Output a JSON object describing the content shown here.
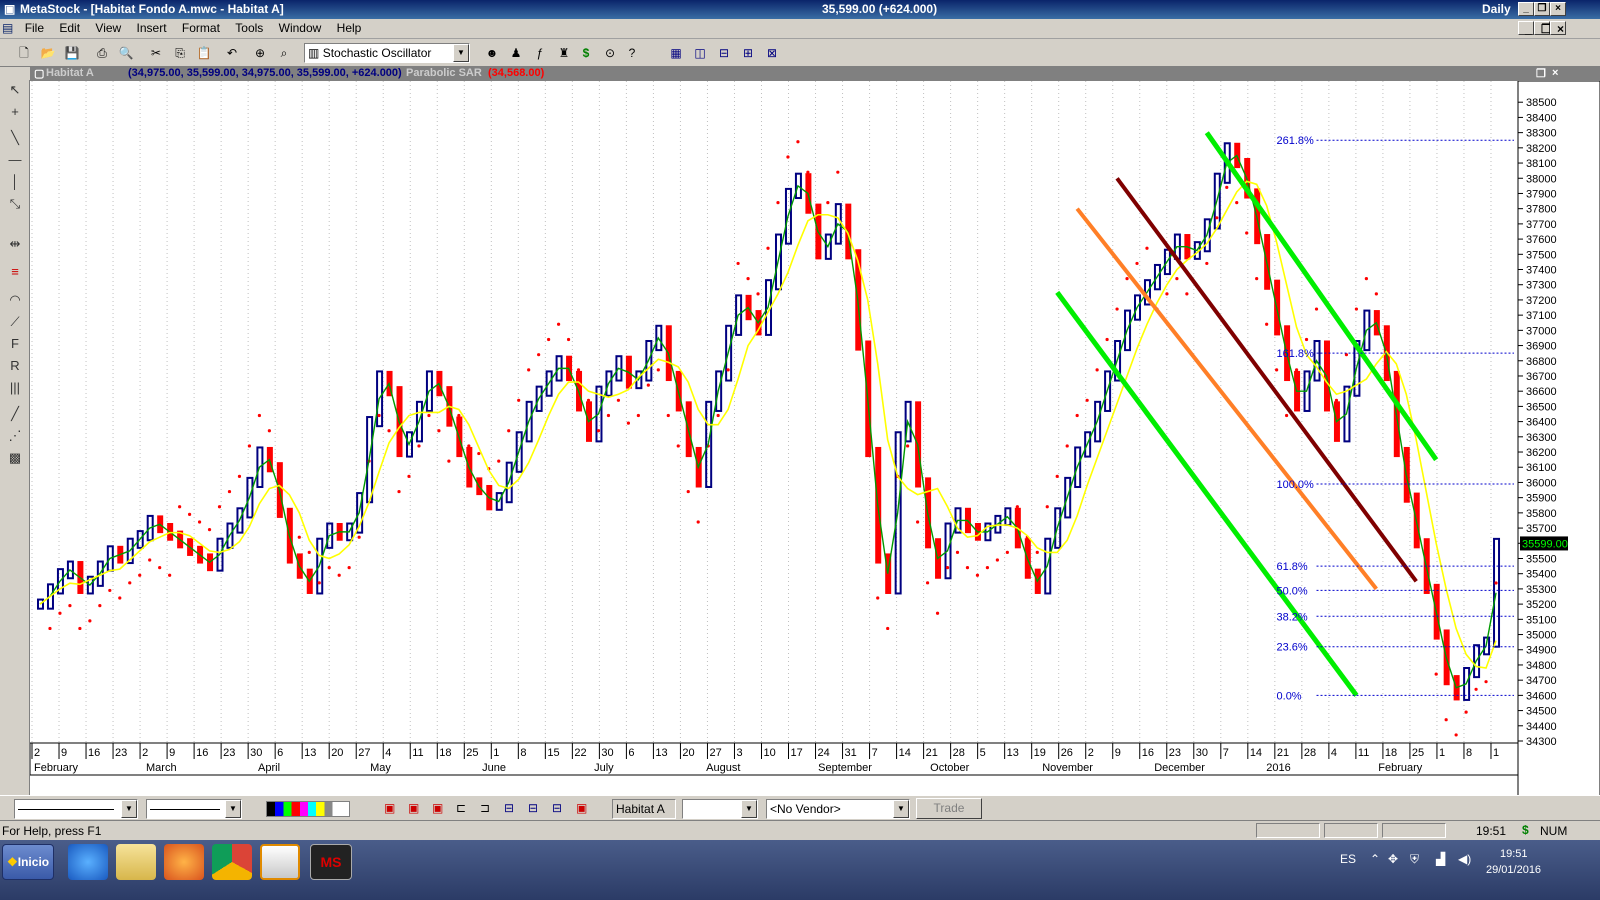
{
  "window": {
    "app_title": "MetaStock - [Habitat Fondo A.mwc - Habitat A]",
    "quote": "35,599.00 (+624.000)",
    "period": "Daily",
    "min_icon": "_",
    "restore_icon": "❐",
    "close_icon": "×"
  },
  "menu": [
    "File",
    "Edit",
    "View",
    "Insert",
    "Format",
    "Tools",
    "Window",
    "Help"
  ],
  "toolbar": {
    "indicator_select": "Stochastic Oscillator"
  },
  "chart_header": {
    "security": "Habitat A",
    "ohlc": "(34,975.00, 35,599.00, 34,975.00, 35,599.00, +624.000)",
    "indicator": "Parabolic SAR",
    "indicator_value": "(34,568.00)"
  },
  "chart_data": {
    "type": "line",
    "ylim": [
      34300,
      38600
    ],
    "y_ticks": [
      34300,
      34400,
      34500,
      34600,
      34700,
      34800,
      34900,
      35000,
      35100,
      35200,
      35300,
      35400,
      35500,
      35600,
      35700,
      35800,
      35900,
      36000,
      36100,
      36200,
      36300,
      36400,
      36500,
      36600,
      36700,
      36800,
      36900,
      37000,
      37100,
      37200,
      37300,
      37400,
      37500,
      37600,
      37700,
      37800,
      37900,
      38000,
      38100,
      38200,
      38300,
      38400,
      38500
    ],
    "last_price_label": "35599.00",
    "day_ticks": [
      "2",
      "9",
      "16",
      "23",
      "2",
      "9",
      "16",
      "23",
      "30",
      "6",
      "13",
      "20",
      "27",
      "4",
      "11",
      "18",
      "25",
      "1",
      "8",
      "15",
      "22",
      "30",
      "6",
      "13",
      "20",
      "27",
      "3",
      "10",
      "17",
      "24",
      "31",
      "7",
      "14",
      "21",
      "28",
      "5",
      "13",
      "19",
      "26",
      "2",
      "9",
      "16",
      "23",
      "30",
      "7",
      "14",
      "21",
      "28",
      "4",
      "11",
      "18",
      "25",
      "1",
      "8",
      "1"
    ],
    "month_labels": [
      "February",
      "March",
      "April",
      "May",
      "June",
      "July",
      "August",
      "September",
      "October",
      "November",
      "December",
      "2016",
      "February"
    ],
    "fib_levels": [
      {
        "label": "261.8%",
        "value": 38250
      },
      {
        "label": "161.8%",
        "value": 36850
      },
      {
        "label": "100.0%",
        "value": 35990
      },
      {
        "label": "61.8%",
        "value": 35450
      },
      {
        "label": "50.0%",
        "value": 35290
      },
      {
        "label": "38.2%",
        "value": 35120
      },
      {
        "label": "23.6%",
        "value": 34920
      },
      {
        "label": "0.0%",
        "value": 34600
      }
    ],
    "series_close": [
      35200,
      35300,
      35400,
      35450,
      35300,
      35350,
      35450,
      35550,
      35500,
      35600,
      35650,
      35750,
      35700,
      35650,
      35600,
      35550,
      35500,
      35450,
      35600,
      35700,
      35800,
      36000,
      36200,
      36100,
      35800,
      35500,
      35400,
      35300,
      35600,
      35700,
      35650,
      35700,
      35900,
      36400,
      36700,
      36600,
      36200,
      36300,
      36500,
      36700,
      36600,
      36400,
      36200,
      36000,
      35950,
      35850,
      35900,
      36100,
      36300,
      36500,
      36600,
      36700,
      36800,
      36700,
      36500,
      36300,
      36600,
      36700,
      36800,
      36650,
      36700,
      36900,
      37000,
      36700,
      36500,
      36200,
      36000,
      36500,
      36700,
      37000,
      37200,
      37100,
      37000,
      37300,
      37600,
      37900,
      38000,
      37800,
      37500,
      37600,
      37800,
      37500,
      36900,
      36200,
      35500,
      35300,
      36300,
      36500,
      36000,
      35600,
      35400,
      35700,
      35800,
      35700,
      35650,
      35700,
      35750,
      35800,
      35600,
      35400,
      35300,
      35600,
      35800,
      36000,
      36200,
      36300,
      36500,
      36700,
      36900,
      37100,
      37200,
      37300,
      37400,
      37500,
      37600,
      37500,
      37550,
      37700,
      38000,
      38200,
      38100,
      37900,
      37600,
      37300,
      37000,
      36700,
      36500,
      36700,
      36900,
      36500,
      36300,
      36600,
      36900,
      37100,
      37000,
      36700,
      36200,
      35900,
      35600,
      35300,
      35000,
      34700,
      34600,
      34750,
      34900,
      34950,
      35599
    ],
    "sar_points_note": "",
    "legend": []
  },
  "bottom": {
    "security_field": "Habitat A",
    "vendor_select": "<No Vendor>",
    "trade_button": "Trade"
  },
  "status": {
    "help_text": "For Help, press F1",
    "time": "19:51",
    "dollar": "$",
    "num": "NUM"
  },
  "taskbar": {
    "start_label": "Inicio",
    "lang": "ES",
    "clock_time": "19:51",
    "clock_date": "29/01/2016"
  },
  "colors": {
    "up_bar": "#000080",
    "down_bar": "#ff0000",
    "sar": "#ff0000",
    "stoch_fast": "#009900",
    "stoch_slow": "#ffff00",
    "trend_green": "#00ee00",
    "trend_orange": "#ff7f27",
    "trend_brown": "#7f0000",
    "fib": "#0000cc"
  }
}
